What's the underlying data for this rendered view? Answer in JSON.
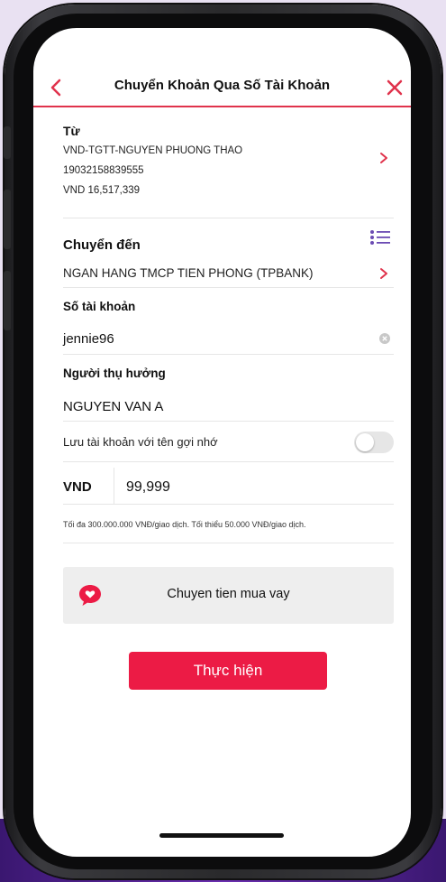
{
  "header": {
    "title": "Chuyển Khoản Qua Số Tài Khoản"
  },
  "from": {
    "label": "Từ",
    "account_name": "VND-TGTT-NGUYEN PHUONG THAO",
    "account_number": "19032158839555",
    "balance": "VND 16,517,339"
  },
  "to": {
    "label": "Chuyển đến",
    "bank": "NGAN HANG TMCP TIEN PHONG (TPBANK)"
  },
  "account": {
    "label": "Số tài khoản",
    "value": "jennie96"
  },
  "beneficiary": {
    "label": "Người thụ hưởng",
    "value": "NGUYEN VAN A"
  },
  "save_account": {
    "label": "Lưu tài khoản với tên gợi nhớ",
    "enabled": false
  },
  "amount": {
    "currency": "VND",
    "value": "99,999",
    "limit_note": "Tối đa 300.000.000 VNĐ/giao dịch. Tối thiểu 50.000 VNĐ/giao dịch."
  },
  "promo": {
    "text": "Chuyen tien mua vay"
  },
  "submit": {
    "label": "Thực hiện"
  },
  "colors": {
    "accent": "#ec1b45",
    "header_line": "#e0334c",
    "icon_purple": "#6b4bb3"
  }
}
